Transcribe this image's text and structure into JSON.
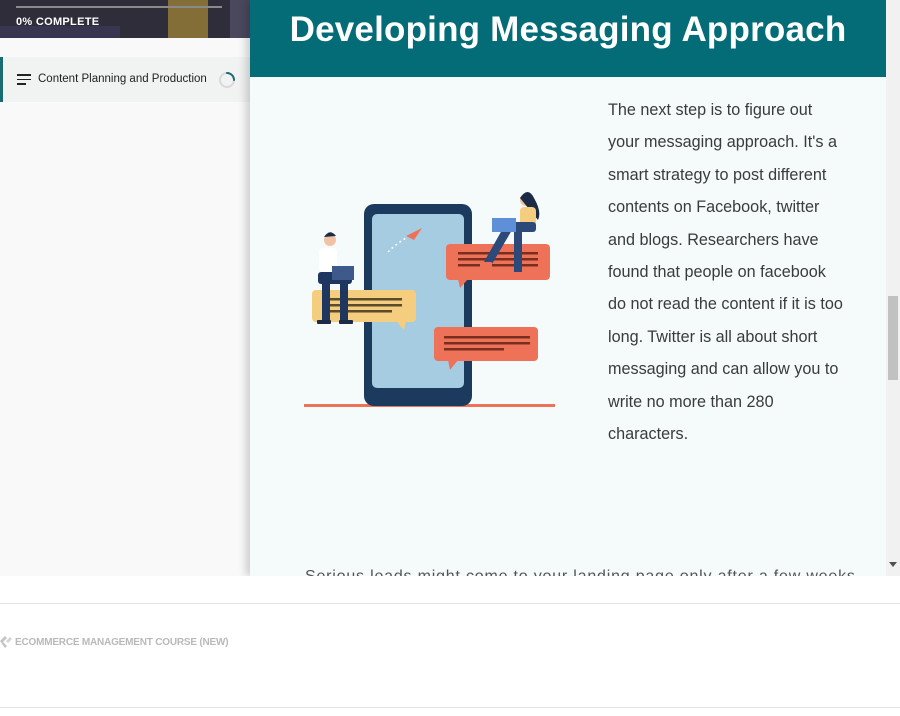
{
  "sidebar": {
    "progress_text": "0% COMPLETE",
    "progress_fraction": 0,
    "lesson": {
      "title": "Content Planning and Production",
      "progress_fraction": 0.25
    }
  },
  "lesson": {
    "heading": "Developing Messaging Approach",
    "paragraph": "The next step is to figure out your messaging approach. It's a smart strategy to post different contents on Facebook, twitter and blogs. Researchers have found that people on facebook do not read the content if it is too long. Twitter is all about short messaging and can allow you to write no more than 280 characters.",
    "next_paragraph_start": "Serious leads might come to your landing page only after a few weeks"
  },
  "footer": {
    "course_label": "ECOMMERCE MANAGEMENT COURSE (NEW)"
  },
  "colors": {
    "header_teal": "#036c77",
    "accent_teal": "#1b6b73",
    "coral": "#ee7257",
    "phone_navy": "#1c3a5e",
    "phone_screen": "#a6cce2"
  },
  "icons": {
    "lesson_menu": "menu-lines-icon",
    "lesson_progress": "progress-ring-icon",
    "footer_course": "course-logo-icon"
  }
}
